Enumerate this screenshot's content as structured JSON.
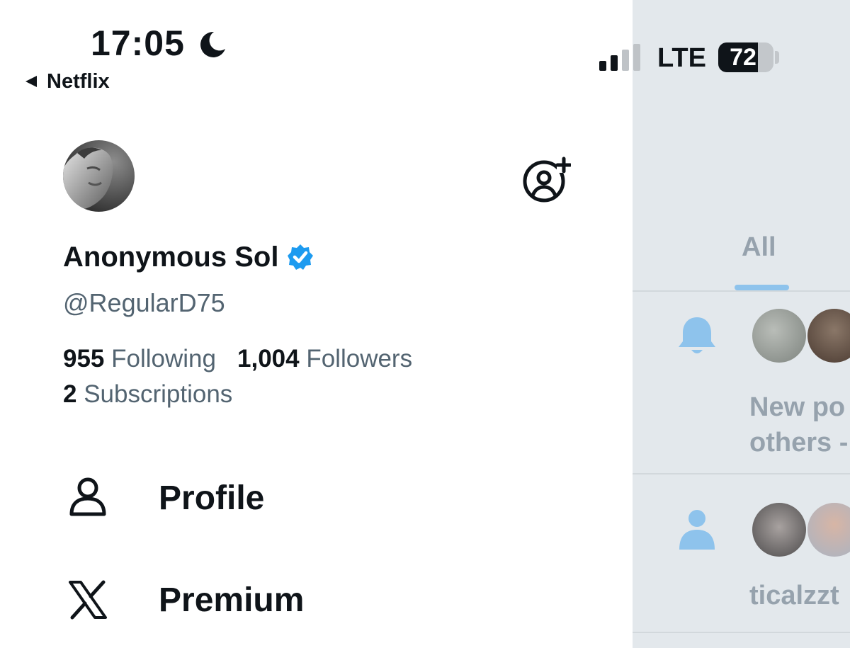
{
  "status_bar": {
    "time": "17:05",
    "back_label": "Netflix",
    "network": "LTE",
    "battery": "72",
    "battery_level": 0.72
  },
  "drawer": {
    "display_name": "Anonymous Sol",
    "handle": "@RegularD75",
    "stats": {
      "following_count": "955",
      "following_label": "Following",
      "followers_count": "1,004",
      "followers_label": "Followers",
      "subscriptions_count": "2",
      "subscriptions_label": "Subscriptions"
    },
    "menu": [
      {
        "label": "Profile",
        "icon": "person-outline-icon"
      },
      {
        "label": "Premium",
        "icon": "x-logo-icon"
      }
    ]
  },
  "notifications": {
    "tab_label": "All",
    "items": [
      {
        "icon": "bell-icon",
        "text_line1": "New po",
        "text_line2": "others -"
      },
      {
        "icon": "person-icon",
        "text_line1": "ticalzzt"
      }
    ]
  },
  "colors": {
    "text": "#0f1419",
    "secondary": "#536471",
    "verified": "#1d9bf0",
    "right_pane_bg": "#e3e8ec",
    "pane_muted_text": "#96a2ad",
    "pane_accent": "#8ec3ec"
  }
}
